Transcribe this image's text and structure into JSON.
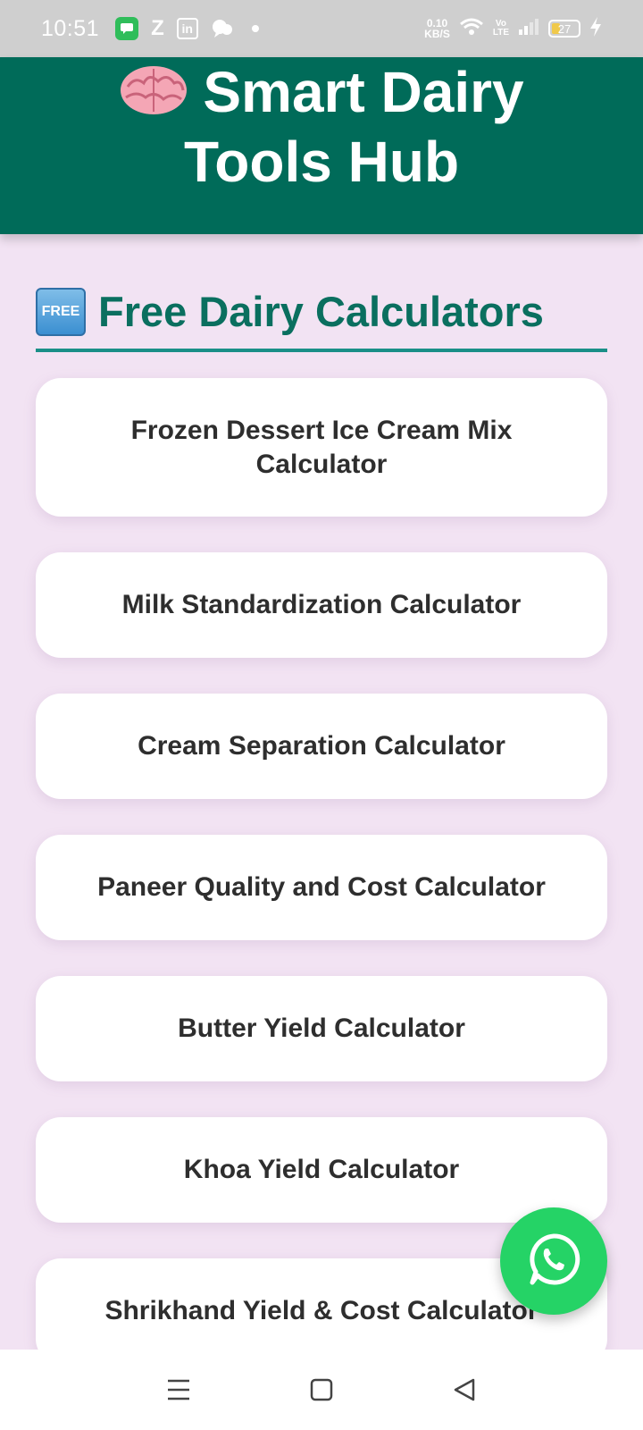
{
  "status_bar": {
    "time": "10:51",
    "network_speed_value": "0.10",
    "network_speed_unit": "KB/S",
    "volte_line1": "Vo",
    "volte_line2": "LTE",
    "battery_level": "27",
    "icons": [
      "message-icon",
      "z-icon",
      "linkedin-icon",
      "bubble-icon",
      "dot-icon",
      "wifi-icon",
      "signal-icon",
      "battery-icon",
      "charging-icon"
    ]
  },
  "header": {
    "title": "Smart Dairy Tools Hub",
    "icon": "brain-icon",
    "background": "#006b59"
  },
  "section": {
    "badge": "FREE",
    "title": "Free Dairy Calculators",
    "title_color": "#0a6f5f"
  },
  "calculators": [
    {
      "label": "Frozen Dessert Ice Cream Mix Calculator"
    },
    {
      "label": "Milk Standardization Calculator"
    },
    {
      "label": "Cream Separation Calculator"
    },
    {
      "label": "Paneer Quality and Cost Calculator"
    },
    {
      "label": "Butter Yield Calculator"
    },
    {
      "label": "Khoa Yield Calculator"
    },
    {
      "label": "Shrikhand Yield & Cost Calculator"
    }
  ],
  "fab": {
    "icon": "whatsapp-icon",
    "color": "#25d366"
  },
  "nav": {
    "icons": [
      "menu-icon",
      "home-square-icon",
      "back-triangle-icon"
    ]
  }
}
